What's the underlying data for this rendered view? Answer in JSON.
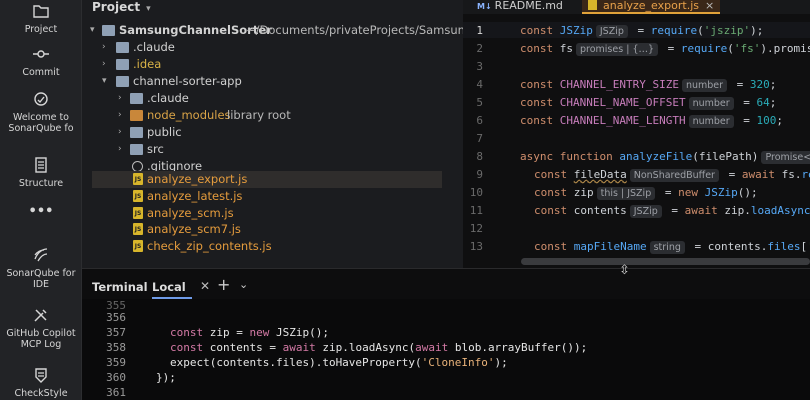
{
  "activity_bar": {
    "items": [
      {
        "label": "Project",
        "icon": "folder-icon"
      },
      {
        "label": "Commit",
        "icon": "commit-icon"
      },
      {
        "label": "Welcome to SonarQube fo",
        "icon": "sonarqube-welcome-icon"
      },
      {
        "label": "Structure",
        "icon": "structure-icon"
      },
      {
        "label": "•••",
        "icon": "more-icon"
      },
      {
        "label": "SonarQube for IDE",
        "icon": "sonarqube-icon"
      },
      {
        "label": "GitHub Copilot MCP Log",
        "icon": "tools-icon"
      },
      {
        "label": "CheckStyle",
        "icon": "checkstyle-icon"
      }
    ]
  },
  "project": {
    "header": "Project",
    "tree": [
      {
        "label": "SamsungChannelSorter",
        "suffix": "~/Documents/privateProjects/SamsungC",
        "kind": "folder",
        "depth": 0,
        "expanded": true
      },
      {
        "label": ".claude",
        "kind": "folder",
        "depth": 1,
        "expanded": false
      },
      {
        "label": ".idea",
        "kind": "folder",
        "depth": 1,
        "expanded": false
      },
      {
        "label": "channel-sorter-app",
        "kind": "folder",
        "depth": 1,
        "expanded": true
      },
      {
        "label": ".claude",
        "kind": "folder",
        "depth": 2,
        "expanded": false
      },
      {
        "label": "node_modules",
        "suffix": "library root",
        "kind": "folder-orange",
        "depth": 2,
        "expanded": false
      },
      {
        "label": "public",
        "kind": "folder",
        "depth": 2,
        "expanded": false
      },
      {
        "label": "src",
        "kind": "folder",
        "depth": 2,
        "expanded": false
      },
      {
        "label": ".gitignore",
        "kind": "ignore",
        "depth": 2
      },
      {
        "label": "analyze_export.js",
        "kind": "js",
        "depth": 2,
        "selected": true
      },
      {
        "label": "analyze_latest.js",
        "kind": "js",
        "depth": 2
      },
      {
        "label": "analyze_scm.js",
        "kind": "js",
        "depth": 2
      },
      {
        "label": "analyze_scm7.js",
        "kind": "js",
        "depth": 2
      },
      {
        "label": "check_zip_contents.js",
        "kind": "js",
        "depth": 2
      }
    ]
  },
  "editor": {
    "tabs": [
      {
        "badge": "M↓",
        "label": "README.md",
        "active": false
      },
      {
        "label": "analyze_export.js",
        "active": true
      }
    ],
    "line_numbers": [
      "1",
      "2",
      "3",
      "4",
      "5",
      "6",
      "7",
      "8",
      "9",
      "10",
      "11",
      "12",
      "13"
    ],
    "hints": {
      "l1": "JSZip",
      "l2a": "promises",
      "l2b": "{…}",
      "l4": "number",
      "l5": "number",
      "l6": "number",
      "l8": "Promise<",
      "l9": "NonSharedBuffer",
      "l10a": "this",
      "l10b": "JSZip",
      "l11": "JSZip",
      "l13": "string"
    }
  },
  "terminal": {
    "title": "Terminal",
    "tab_label": "Local",
    "line_numbers": [
      "355",
      "356",
      "357",
      "358",
      "359",
      "360",
      "361"
    ],
    "lines": {
      "l357_kw": "const",
      "l357_a": " zip = ",
      "l357_new": "new",
      "l357_b": " JSZip();",
      "l358_kw": "const",
      "l358_a": " contents = ",
      "l358_await1": "await",
      "l358_b": " zip.loadAsync(",
      "l358_await2": "await",
      "l358_c": " blob.arrayBuffer());",
      "l359_a": "expect(contents.files).toHaveProperty(",
      "l359_str": "'CloneInfo'",
      "l359_b": ");",
      "l360": "});"
    }
  },
  "colors": {
    "accent": "#e0a23a",
    "keyword": "#cf8e6d",
    "function": "#56a8f5",
    "constant": "#c77dbb",
    "number": "#2aacb8",
    "string": "#6aab73"
  }
}
